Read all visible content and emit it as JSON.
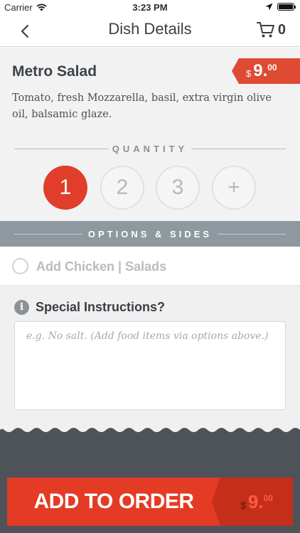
{
  "status_bar": {
    "carrier": "Carrier",
    "time": "3:23 PM"
  },
  "nav": {
    "title": "Dish Details",
    "cart_count": "0"
  },
  "dish": {
    "name": "Metro Salad",
    "price_currency": "$",
    "price_int": "9.",
    "price_dec": "00",
    "description": "Tomato, fresh Mozzarella, basil, extra virgin olive oil, balsamic glaze."
  },
  "quantity": {
    "header": "QUANTITY",
    "options": [
      "1",
      "2",
      "3",
      "+"
    ],
    "selected": "1"
  },
  "options": {
    "header": "OPTIONS & SIDES",
    "items": [
      {
        "label": "Add Chicken | Salads",
        "checked": false
      }
    ]
  },
  "instructions": {
    "label": "Special Instructions?",
    "placeholder": "e.g. No salt. (Add food items via options above.)"
  },
  "add_button": {
    "label": "ADD TO ORDER",
    "price_currency": "$",
    "price_int": "9.",
    "price_dec": "00"
  },
  "colors": {
    "accent_red": "#e33b24",
    "options_bar": "#8e989f",
    "footer": "#4e535a"
  },
  "icons": {
    "back": "chevron-left-icon",
    "cart": "cart-icon",
    "info": "info-icon",
    "wifi": "wifi-icon",
    "location": "location-arrow-icon",
    "battery": "battery-icon"
  }
}
